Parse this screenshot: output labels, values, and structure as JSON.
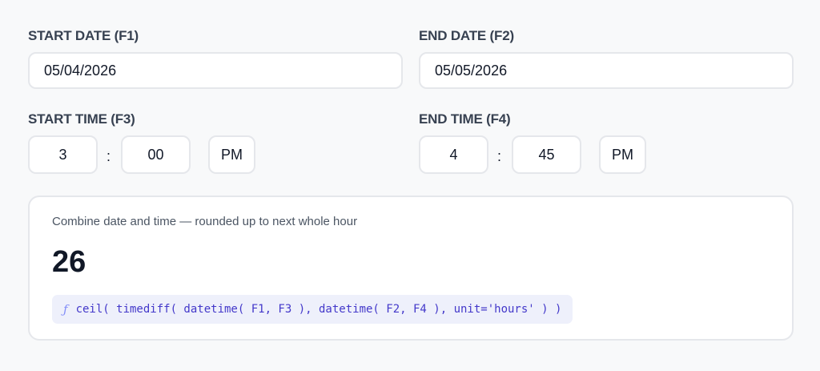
{
  "start_date": {
    "label": "START DATE (F1)",
    "value": "05/04/2026"
  },
  "end_date": {
    "label": "END DATE (F2)",
    "value": "05/05/2026"
  },
  "start_time": {
    "label": "START TIME (F3)",
    "hour": "3",
    "separator": ":",
    "minute": "00",
    "ampm": "PM"
  },
  "end_time": {
    "label": "END TIME (F4)",
    "hour": "4",
    "separator": ":",
    "minute": "45",
    "ampm": "PM"
  },
  "result": {
    "description": "Combine date and time — rounded up to next whole hour",
    "value": "26",
    "formula_icon": "ƒ",
    "formula": "ceil( timediff( datetime( F1, F3 ), datetime( F2, F4 ), unit='hours' ) )"
  },
  "colors": {
    "background": "#f8f9fa",
    "formula_text": "#4338ca",
    "formula_bg": "#eef0fb"
  }
}
